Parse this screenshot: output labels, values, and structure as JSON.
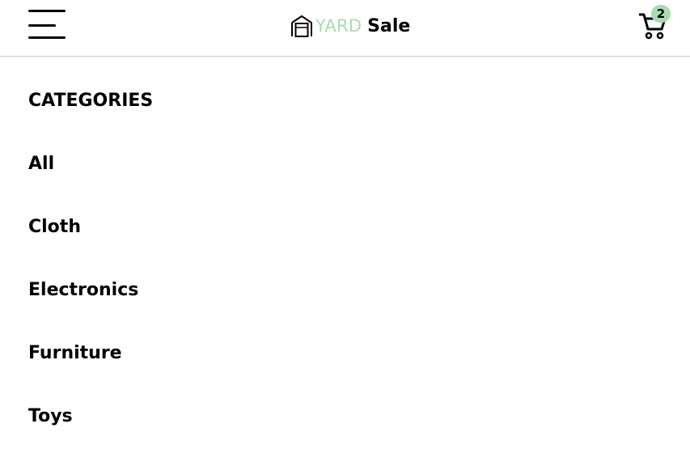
{
  "header": {
    "brand_yard": "YARD",
    "brand_sale": "Sale",
    "cart_count": "2",
    "accent_color": "#acd9b2"
  },
  "icons": {
    "menu": "menu-icon",
    "logo": "garage-icon",
    "cart": "cart-icon"
  },
  "categories": {
    "title": "CATEGORIES",
    "items": [
      {
        "label": "All"
      },
      {
        "label": "Cloth"
      },
      {
        "label": "Electronics"
      },
      {
        "label": "Furniture"
      },
      {
        "label": "Toys"
      }
    ]
  }
}
